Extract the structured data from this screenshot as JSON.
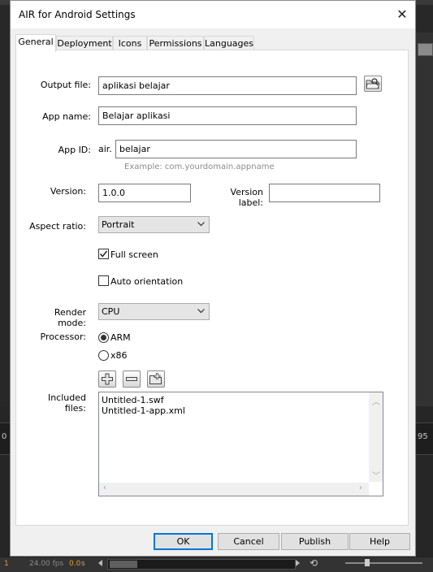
{
  "dialog": {
    "title": "AIR for Android Settings",
    "close_glyph": "✕"
  },
  "tabs": [
    {
      "label": "General",
      "active": true
    },
    {
      "label": "Deployment",
      "active": false
    },
    {
      "label": "Icons",
      "active": false
    },
    {
      "label": "Permissions",
      "active": false
    },
    {
      "label": "Languages",
      "active": false
    }
  ],
  "general": {
    "output_file": {
      "label": "Output file:",
      "value": "aplikasi belajar",
      "browse_icon": "folder-browse-icon"
    },
    "app_name": {
      "label": "App name:",
      "value": "Belajar aplikasi"
    },
    "app_id": {
      "label": "App ID:",
      "prefix": "air.",
      "value": "belajar",
      "hint": "Example: com.yourdomain.appname"
    },
    "version": {
      "label": "Version:",
      "value": "1.0.0"
    },
    "version_label": {
      "label": "Version label:",
      "value": ""
    },
    "aspect_ratio": {
      "label": "Aspect ratio:",
      "value": "Portrait"
    },
    "full_screen": {
      "label": "Full screen",
      "checked": true
    },
    "auto_orientation": {
      "label": "Auto orientation",
      "checked": false
    },
    "render_mode": {
      "label": "Render mode:",
      "value": "CPU"
    },
    "processor": {
      "label": "Processor:",
      "options": [
        "ARM",
        "x86"
      ],
      "selected": "ARM"
    },
    "included_files": {
      "label": "Included files:",
      "files": [
        "Untitled-1.swf",
        "Untitled-1-app.xml"
      ],
      "buttons": [
        "add-file-icon",
        "remove-file-icon",
        "add-folder-icon"
      ]
    }
  },
  "footer": {
    "ok": "OK",
    "cancel": "Cancel",
    "publish": "Publish",
    "help": "Help"
  },
  "background": {
    "timeline_left_number": "0",
    "timeline_right_number": "95",
    "status_frame": "1",
    "status_fps": "24.00 fps",
    "status_time": "0.0",
    "status_time_unit": "s"
  },
  "colors": {
    "default_button_border": "#0078d7",
    "status_accent": "#e89a28"
  }
}
